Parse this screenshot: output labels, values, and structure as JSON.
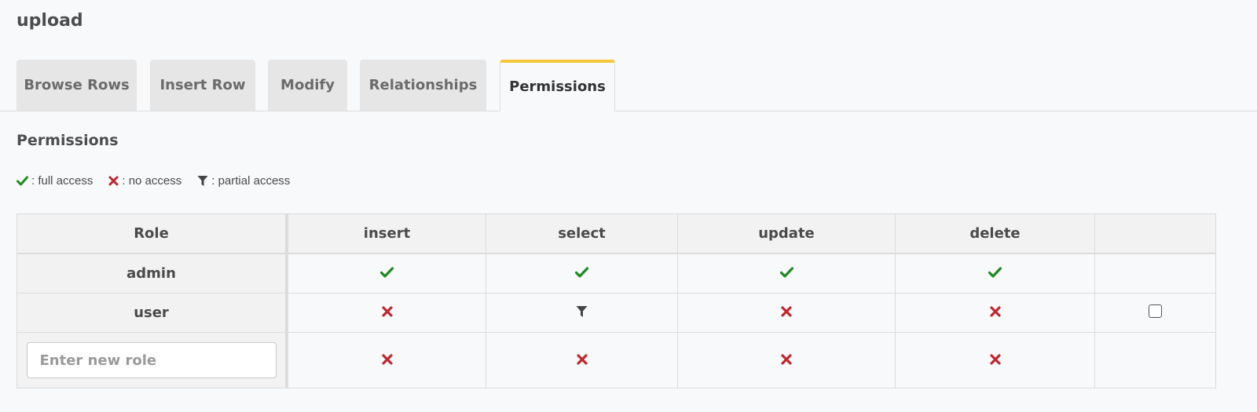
{
  "page": {
    "title": "upload"
  },
  "tabs": [
    {
      "label": "Browse Rows",
      "active": false
    },
    {
      "label": "Insert Row",
      "active": false
    },
    {
      "label": "Modify",
      "active": false
    },
    {
      "label": "Relationships",
      "active": false
    },
    {
      "label": "Permissions",
      "active": true
    }
  ],
  "section": {
    "title": "Permissions"
  },
  "legend": {
    "full": ": full access",
    "none": ": no access",
    "partial": ": partial access"
  },
  "colors": {
    "full": "#1f8a1f",
    "none": "#c0272d",
    "partial": "#444444",
    "active_tab": "#f6c73a"
  },
  "table": {
    "headers": [
      "Role",
      "insert",
      "select",
      "update",
      "delete",
      ""
    ],
    "rows": [
      {
        "role": "admin",
        "insert": "full",
        "select": "full",
        "update": "full",
        "delete": "full",
        "bulk": false
      },
      {
        "role": "user",
        "insert": "none",
        "select": "partial",
        "update": "none",
        "delete": "none",
        "bulk": true
      }
    ],
    "new_role": {
      "placeholder": "Enter new role",
      "value": "",
      "insert": "none",
      "select": "none",
      "update": "none",
      "delete": "none"
    }
  }
}
